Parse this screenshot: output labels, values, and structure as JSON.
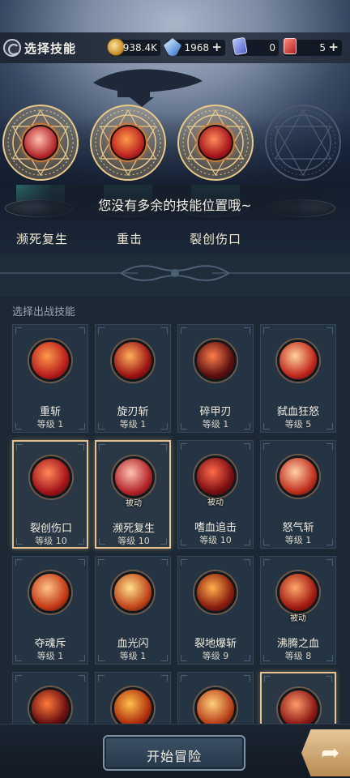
{
  "header": {
    "title": "选择技能",
    "resources": [
      {
        "name": "gold",
        "value": "938.4K",
        "icon": "gold-coin-icon"
      },
      {
        "name": "crystal",
        "value": "1968",
        "icon": "crystal-icon",
        "plus": "+"
      },
      {
        "name": "ticket",
        "value": "0",
        "icon": "ticket-icon"
      },
      {
        "name": "card",
        "value": "5",
        "icon": "card-icon",
        "plus": "+"
      }
    ]
  },
  "equipped": {
    "slots": [
      {
        "label": "濒死复生",
        "icon": "near-death-revive-icon"
      },
      {
        "label": "重击",
        "icon": "heavy-strike-icon"
      },
      {
        "label": "裂创伤口",
        "icon": "rend-wound-icon"
      },
      {
        "label": "",
        "icon": "empty-slot-icon"
      }
    ],
    "notice": "您没有多余的技能位置哦~"
  },
  "list": {
    "title": "选择出战技能",
    "skills": [
      {
        "name": "重斩",
        "level": "等级 1",
        "badge": "",
        "selected": false,
        "colors": [
          "#ff9a4a",
          "#b81e1e"
        ]
      },
      {
        "name": "旋刃斩",
        "level": "等级 1",
        "badge": "",
        "selected": false,
        "colors": [
          "#ffb05a",
          "#9c1414"
        ]
      },
      {
        "name": "碎甲刃",
        "level": "等级 1",
        "badge": "",
        "selected": false,
        "colors": [
          "#ff7e4a",
          "#5a0f0f"
        ]
      },
      {
        "name": "弑血狂怒",
        "level": "等级 5",
        "badge": "",
        "selected": false,
        "colors": [
          "#ffd29a",
          "#c2271e"
        ]
      },
      {
        "name": "裂创伤口",
        "level": "等级 10",
        "badge": "",
        "selected": true,
        "colors": [
          "#ff8a5a",
          "#a3121a"
        ]
      },
      {
        "name": "濒死复生",
        "level": "等级 10",
        "badge": "被动",
        "selected": true,
        "colors": [
          "#ffc2b0",
          "#b3242a"
        ]
      },
      {
        "name": "嗜血追击",
        "level": "等级 10",
        "badge": "被动",
        "selected": false,
        "colors": [
          "#ff6a4a",
          "#7a0e12"
        ]
      },
      {
        "name": "怒气斩",
        "level": "等级 1",
        "badge": "",
        "selected": false,
        "colors": [
          "#ffd0a8",
          "#c2301e"
        ]
      },
      {
        "name": "夺魂斥",
        "level": "等级 1",
        "badge": "",
        "selected": false,
        "colors": [
          "#ffc48a",
          "#c23a16"
        ]
      },
      {
        "name": "血光闪",
        "level": "等级 1",
        "badge": "",
        "selected": false,
        "colors": [
          "#ffe08a",
          "#c0451a"
        ]
      },
      {
        "name": "裂地爆斩",
        "level": "等级 9",
        "badge": "",
        "selected": false,
        "colors": [
          "#ffb04a",
          "#8a1c10"
        ]
      },
      {
        "name": "沸腾之血",
        "level": "等级 8",
        "badge": "被动",
        "selected": false,
        "colors": [
          "#ffa86a",
          "#a31a12"
        ]
      },
      {
        "name": "",
        "level": "",
        "badge": "",
        "selected": false,
        "colors": [
          "#ff7a3a",
          "#6a1010"
        ]
      },
      {
        "name": "",
        "level": "",
        "badge": "",
        "selected": false,
        "colors": [
          "#ffc04a",
          "#b0300e"
        ]
      },
      {
        "name": "",
        "level": "",
        "badge": "",
        "selected": false,
        "colors": [
          "#ffd07a",
          "#b8401a"
        ]
      },
      {
        "name": "",
        "level": "",
        "badge": "",
        "selected": true,
        "colors": [
          "#ff9a6a",
          "#8c1a14"
        ]
      }
    ]
  },
  "footer": {
    "start_label": "开始冒险",
    "next_icon": "share-arrow-icon"
  }
}
